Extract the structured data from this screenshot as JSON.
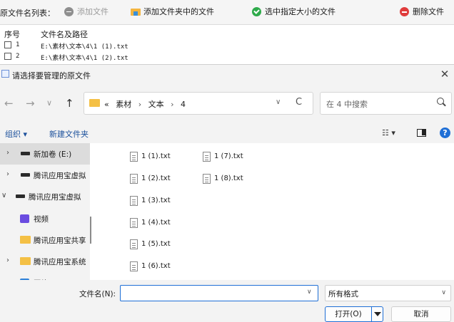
{
  "app": {
    "file_list_label": "原文件名列表：",
    "toolbar": {
      "add_file": "添加文件",
      "add_folder_files": "添加文件夹中的文件",
      "select_by_size": "选中指定大小的文件",
      "delete_file": "删除文件"
    },
    "table": {
      "col_index": "序号",
      "col_path": "文件名及路径",
      "rows": [
        {
          "index": "1",
          "path": "E:\\素材\\文本\\4\\1 (1).txt"
        },
        {
          "index": "2",
          "path": "E:\\素材\\文本\\4\\1 (2).txt"
        }
      ]
    }
  },
  "dialog": {
    "title": "请选择要管理的原文件",
    "close_glyph": "✕",
    "nav": {
      "back": "←",
      "forward": "→",
      "recent": "∨",
      "up": "↑"
    },
    "address": {
      "overflow": "«",
      "crumbs": [
        "素材",
        "文本",
        "4"
      ],
      "separator": "›",
      "dropdown": "∨",
      "refresh": "C"
    },
    "search_placeholder": "在 4 中搜索",
    "commands": {
      "organize": "组织 ▾",
      "new_folder": "新建文件夹",
      "view_menu": "☷ ▾",
      "help": "?"
    },
    "sidebar": [
      {
        "label": "新加卷 (E:)",
        "chevron": "›",
        "icon": "drive"
      },
      {
        "label": "腾讯应用宝虚拟",
        "chevron": "›",
        "icon": "drive"
      },
      {
        "label": "腾讯应用宝虚拟",
        "chevron": "∨",
        "icon": "drive"
      },
      {
        "label": "视频",
        "chevron": "",
        "icon": "video"
      },
      {
        "label": "腾讯应用宝共享",
        "chevron": "",
        "icon": "folder"
      },
      {
        "label": "腾讯应用宝系统",
        "chevron": "›",
        "icon": "folder"
      },
      {
        "label": "图片",
        "chevron": "",
        "icon": "picture"
      }
    ],
    "files": [
      "1 (1).txt",
      "1 (2).txt",
      "1 (3).txt",
      "1 (4).txt",
      "1 (5).txt",
      "1 (6).txt",
      "1 (7).txt",
      "1 (8).txt"
    ],
    "filename_label": "文件名(N):",
    "filename_value": "",
    "filename_dropdown": "∨",
    "filter_value": "所有格式",
    "filter_dropdown": "∨",
    "open_button": "打开(O)",
    "cancel_button": "取消"
  }
}
